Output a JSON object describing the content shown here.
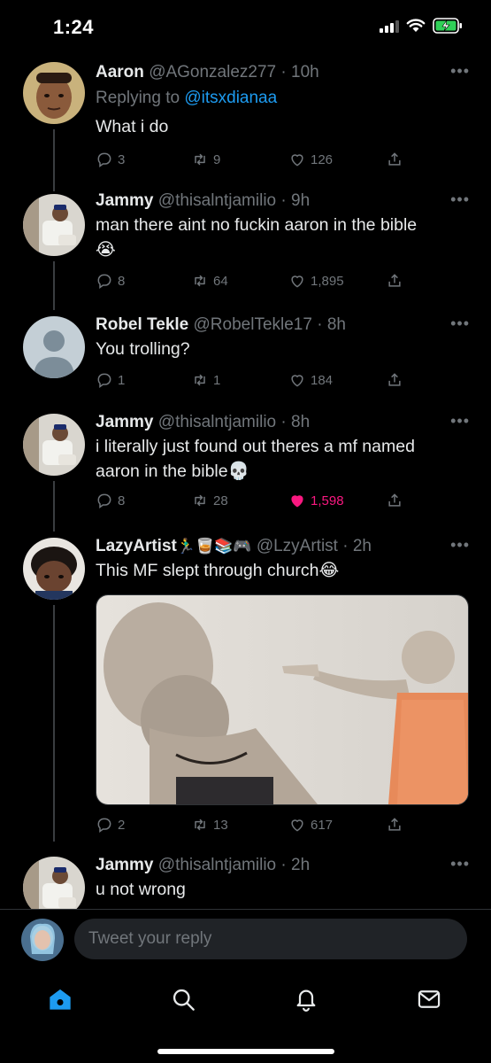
{
  "status_bar": {
    "time": "1:24"
  },
  "tweets": [
    {
      "name": "Aaron",
      "handle": "@AGonzalez277",
      "time": "10h",
      "replying_label": "Replying to",
      "replying_to": "@itsxdianaa",
      "text": "What i do",
      "replies": "3",
      "retweets": "9",
      "likes": "126"
    },
    {
      "name": "Jammy",
      "handle": "@thisalntjamilio",
      "time": "9h",
      "text": "man there aint no fuckin aaron in the bible",
      "emoji": "😭",
      "replies": "8",
      "retweets": "64",
      "likes": "1,895"
    },
    {
      "name": "Robel Tekle",
      "handle": "@RobelTekle17",
      "time": "8h",
      "text": "You trolling?",
      "replies": "1",
      "retweets": "1",
      "likes": "184"
    },
    {
      "name": "Jammy",
      "handle": "@thisalntjamilio",
      "time": "8h",
      "text_line1": "i literally just found out theres a mf named",
      "text_line2": "aaron in the bible💀",
      "replies": "8",
      "retweets": "28",
      "likes": "1,598"
    },
    {
      "name": "LazyArtist",
      "name_emoji": "🏃‍♂️🥃📚🎮",
      "handle": "@LzyArtist",
      "time": "2h",
      "text": "This MF slept through church😂",
      "replies": "2",
      "retweets": "13",
      "likes": "617"
    },
    {
      "name": "Jammy",
      "handle": "@thisalntjamilio",
      "time": "2h",
      "text": "u not wrong"
    }
  ],
  "composer": {
    "placeholder": "Tweet your reply"
  },
  "colors": {
    "accent": "#1d9bf0",
    "like": "#f91880",
    "muted": "#71767b"
  }
}
